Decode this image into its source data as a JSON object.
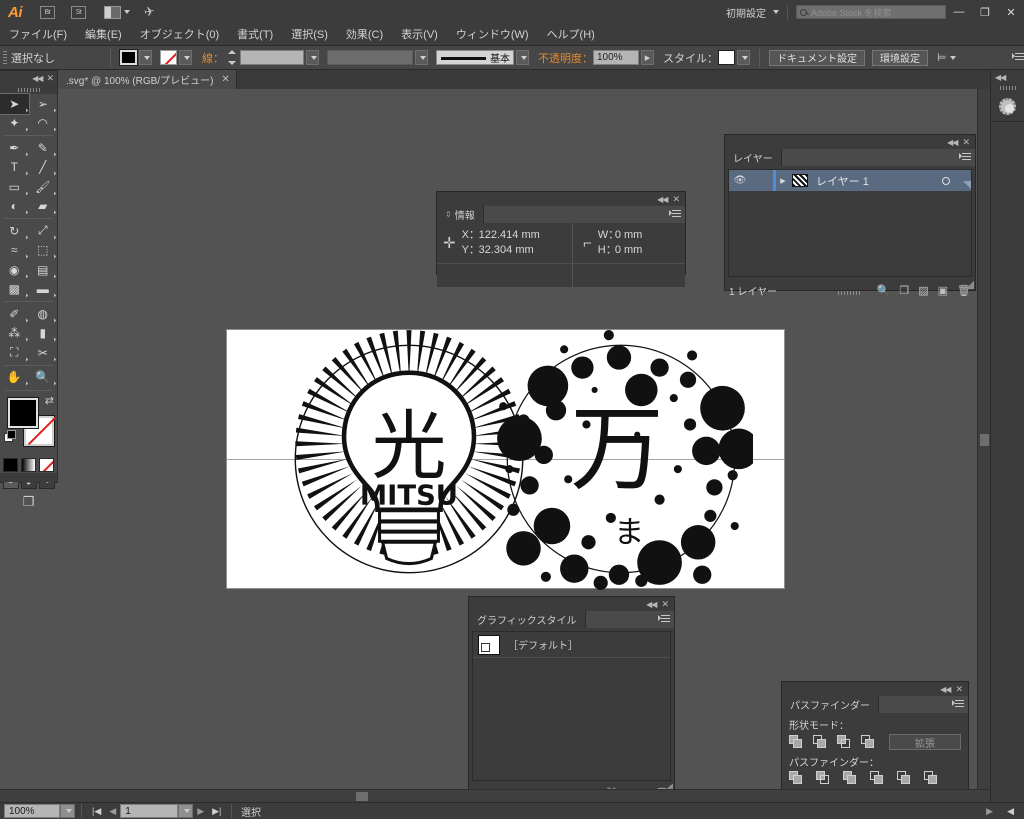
{
  "app": {
    "name": "Ai",
    "bridge_label": "Br",
    "stock_label": "St",
    "workspace_name": "初期設定",
    "search_placeholder": "Adobe Stock を検索",
    "minimize": "—",
    "restore": "❐",
    "close": "✕"
  },
  "menu": {
    "items": [
      {
        "label": "ファイル(F)"
      },
      {
        "label": "編集(E)"
      },
      {
        "label": "オブジェクト(0)"
      },
      {
        "label": "書式(T)"
      },
      {
        "label": "選択(S)"
      },
      {
        "label": "効果(C)"
      },
      {
        "label": "表示(V)"
      },
      {
        "label": "ウィンドウ(W)"
      },
      {
        "label": "ヘルプ(H)"
      }
    ]
  },
  "control_bar": {
    "selection_status": "選択なし",
    "stroke_label": "線：",
    "stroke_weight_value": "",
    "profile_value": "",
    "brush_label": "基本",
    "opacity_label": "不透明度：",
    "opacity_value": "100%",
    "style_label": "スタイル：",
    "document_setup_button": "ドキュメント設定",
    "preferences_button": "環境設定"
  },
  "tab": {
    "title": ".svg* @ 100% (RGB/プレビュー)",
    "close": "✕"
  },
  "toolbar": {
    "tools": [
      {
        "name": "selection-tool",
        "glyph": "➤"
      },
      {
        "name": "direct-selection-tool",
        "glyph": "➢"
      },
      {
        "name": "magic-wand-tool",
        "glyph": "✦"
      },
      {
        "name": "lasso-tool",
        "glyph": "◠"
      },
      {
        "name": "pen-tool",
        "glyph": "✒"
      },
      {
        "name": "curvature-tool",
        "glyph": "✎"
      },
      {
        "name": "type-tool",
        "glyph": "T"
      },
      {
        "name": "line-segment-tool",
        "glyph": "╱"
      },
      {
        "name": "rectangle-tool",
        "glyph": "▭"
      },
      {
        "name": "paintbrush-tool",
        "glyph": "🖌"
      },
      {
        "name": "shaper-tool",
        "glyph": "◐"
      },
      {
        "name": "eraser-tool",
        "glyph": "▰"
      },
      {
        "name": "rotate-tool",
        "glyph": "↻"
      },
      {
        "name": "scale-tool",
        "glyph": "⤢"
      },
      {
        "name": "width-tool",
        "glyph": "≈"
      },
      {
        "name": "free-transform-tool",
        "glyph": "⬚"
      },
      {
        "name": "shape-builder-tool",
        "glyph": "◉"
      },
      {
        "name": "perspective-grid-tool",
        "glyph": "▤"
      },
      {
        "name": "mesh-tool",
        "glyph": "▩"
      },
      {
        "name": "gradient-tool",
        "glyph": "▬"
      },
      {
        "name": "eyedropper-tool",
        "glyph": "✐"
      },
      {
        "name": "blend-tool",
        "glyph": "◍"
      },
      {
        "name": "symbol-sprayer-tool",
        "glyph": "⁂"
      },
      {
        "name": "column-graph-tool",
        "glyph": "▮"
      },
      {
        "name": "artboard-tool",
        "glyph": "⛶"
      },
      {
        "name": "slice-tool",
        "glyph": "✂"
      },
      {
        "name": "hand-tool",
        "glyph": "✋"
      },
      {
        "name": "zoom-tool",
        "glyph": "🔍"
      }
    ],
    "fill_color": "#000000",
    "stroke_color": "#ffffff",
    "swap_glyph": "⇄"
  },
  "info_panel": {
    "tab_label": "情報",
    "x_label": "X：",
    "x_value": "122.414 mm",
    "y_label": "Y：",
    "y_value": "32.304 mm",
    "w_label": "W：",
    "w_value": "0 mm",
    "h_label": "H：",
    "h_value": "0 mm"
  },
  "layers_panel": {
    "tab_label": "レイヤー",
    "rows": [
      {
        "name": "レイヤー 1",
        "visible": true,
        "selected": true
      }
    ],
    "footer_count": "1 レイヤー",
    "footer_icons": [
      "locate-object-icon",
      "make-sublayer-icon",
      "make-mask-icon",
      "new-layer-icon",
      "delete-layer-icon"
    ]
  },
  "graphic_styles_panel": {
    "tab_label": "グラフィックスタイル",
    "items": [
      {
        "label": "［デフォルト］"
      }
    ],
    "footer_icons": [
      "styles-library-icon",
      "break-link-icon",
      "new-style-icon",
      "delete-style-icon"
    ]
  },
  "pathfinder_panel": {
    "tab_label": "パスファインダー",
    "shape_mode_label": "形状モード：",
    "expand_button": "拡張",
    "pathfinder_label": "パスファインダー：",
    "shape_modes": [
      "unite-icon",
      "minus-front-icon",
      "intersect-icon",
      "exclude-icon"
    ],
    "pathfinders": [
      "divide-icon",
      "trim-icon",
      "merge-icon",
      "crop-icon",
      "outline-icon",
      "minus-back-icon"
    ]
  },
  "right_dock": {
    "items": [
      {
        "name": "properties-icon"
      }
    ]
  },
  "status_bar": {
    "zoom_value": "100%",
    "page_value": "1",
    "status_text": "選択",
    "first_glyph": "|◀",
    "prev_glyph": "◀",
    "next_glyph": "▶",
    "last_glyph": "▶|"
  },
  "artwork": {
    "left_mark": {
      "kanji": "光",
      "romaji": "MITSU",
      "description": "lightbulb-with-sun-rays-emblem"
    },
    "right_mark": {
      "kanji": "万",
      "kana": "ま",
      "description": "dotted-circle-emblem"
    }
  }
}
